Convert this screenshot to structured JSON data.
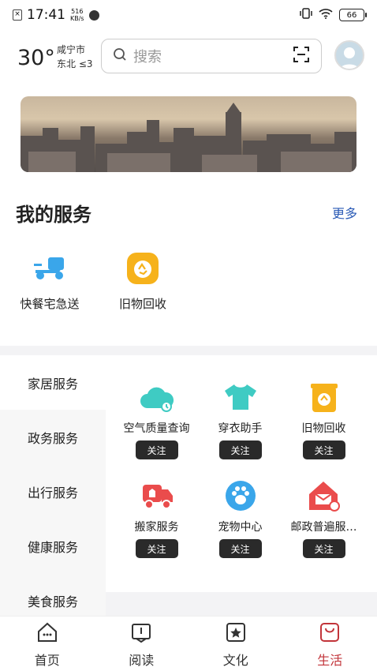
{
  "status": {
    "time": "17:41",
    "net_speed_top": "516",
    "net_speed_unit": "KB/s",
    "battery": "66"
  },
  "header": {
    "temperature": "30°",
    "city": "咸宁市",
    "wind": "东北 ≤3",
    "search_placeholder": "搜索"
  },
  "my_services": {
    "title": "我的服务",
    "more": "更多",
    "items": [
      {
        "label": "快餐宅急送",
        "icon": "delivery-scooter-icon"
      },
      {
        "label": "旧物回收",
        "icon": "recycle-icon"
      }
    ]
  },
  "categories": [
    "家居服务",
    "政务服务",
    "出行服务",
    "健康服务",
    "美食服务"
  ],
  "grid": [
    {
      "label": "空气质量查询",
      "icon": "air-quality-icon",
      "button": "关注"
    },
    {
      "label": "穿衣助手",
      "icon": "tshirt-icon",
      "button": "关注"
    },
    {
      "label": "旧物回收",
      "icon": "recycle-bin-icon",
      "button": "关注"
    },
    {
      "label": "搬家服务",
      "icon": "moving-truck-icon",
      "button": "关注"
    },
    {
      "label": "宠物中心",
      "icon": "paw-icon",
      "button": "关注"
    },
    {
      "label": "邮政普遍服…",
      "icon": "postal-house-icon",
      "button": "关注"
    }
  ],
  "tabs": [
    {
      "label": "首页",
      "icon": "home-icon"
    },
    {
      "label": "阅读",
      "icon": "book-icon"
    },
    {
      "label": "文化",
      "icon": "star-box-icon"
    },
    {
      "label": "生活",
      "icon": "bag-icon"
    }
  ],
  "colors": {
    "accent": "#2b5bb6",
    "active_tab": "#c2343a",
    "teal": "#3fcbc3",
    "orange": "#f6b21b",
    "red": "#ea4c4c",
    "blue": "#3aa6ea"
  }
}
